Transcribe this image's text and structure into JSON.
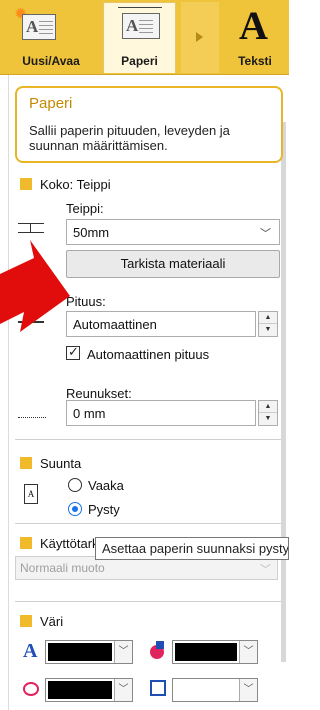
{
  "tabs": [
    {
      "label": "Uusi/Avaa"
    },
    {
      "label": "Paperi"
    },
    {
      "label": "Teksti"
    }
  ],
  "info": {
    "title": "Paperi",
    "description": "Sallii paperin pituuden, leveyden ja suunnan määrittämisen."
  },
  "size": {
    "header": "Koko: Teippi",
    "tape_label": "Teippi:",
    "tape_value": "50mm",
    "check_button": "Tarkista materiaali",
    "length_label": "Pituus:",
    "length_value": "Automaattinen",
    "auto_length_label": "Automaattinen pituus",
    "auto_length_checked": true,
    "margins_label": "Reunukset:",
    "margins_value": "0 mm"
  },
  "orientation": {
    "header": "Suunta",
    "options": [
      "Vaaka",
      "Pysty"
    ],
    "selected": "Pysty",
    "tooltip": "Asettaa paperin suunnaksi pystysuunnan"
  },
  "usage": {
    "header": "Käyttötarkoitus",
    "mode_value": "Normaali muoto"
  },
  "color": {
    "header": "Väri",
    "text_color": "#000000",
    "fill_color": "#000000",
    "frame_color": "#000000",
    "background_color": "#ffffff"
  },
  "accent": "#f0c43a",
  "highlight": "#e8b526"
}
